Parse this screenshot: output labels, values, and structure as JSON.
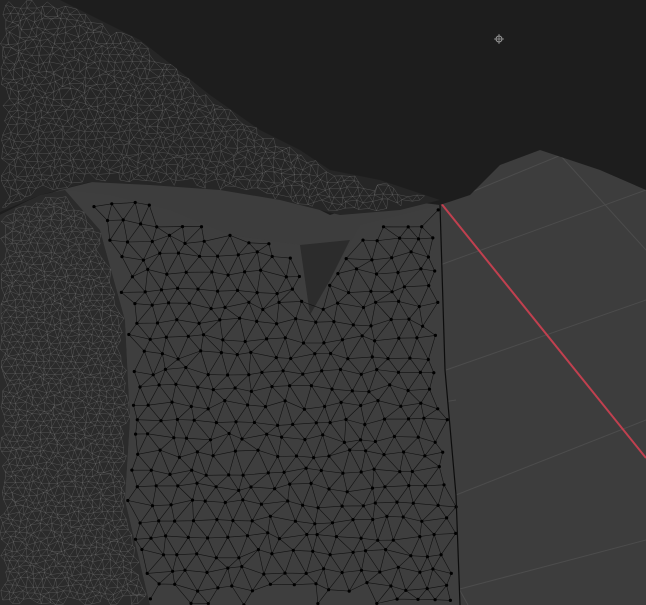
{
  "viewport": {
    "name": "3d-viewport",
    "mode": "edit-mode-wireframe-overlay",
    "grid_visible": true,
    "x_axis_visible": true
  },
  "colors": {
    "background": "#3d3d3d",
    "grid_line": "#4a4a4a",
    "x_axis": "#c0404f",
    "mesh_face": "#3f3f3f",
    "mesh_face_dark": "#262626",
    "terrain_top": "#1c1c1c",
    "wire": "#0c0c0c",
    "wire_light": "#8a8a8a",
    "vertex": "#000000"
  },
  "icons": {
    "cursor": "3d-cursor-icon"
  }
}
